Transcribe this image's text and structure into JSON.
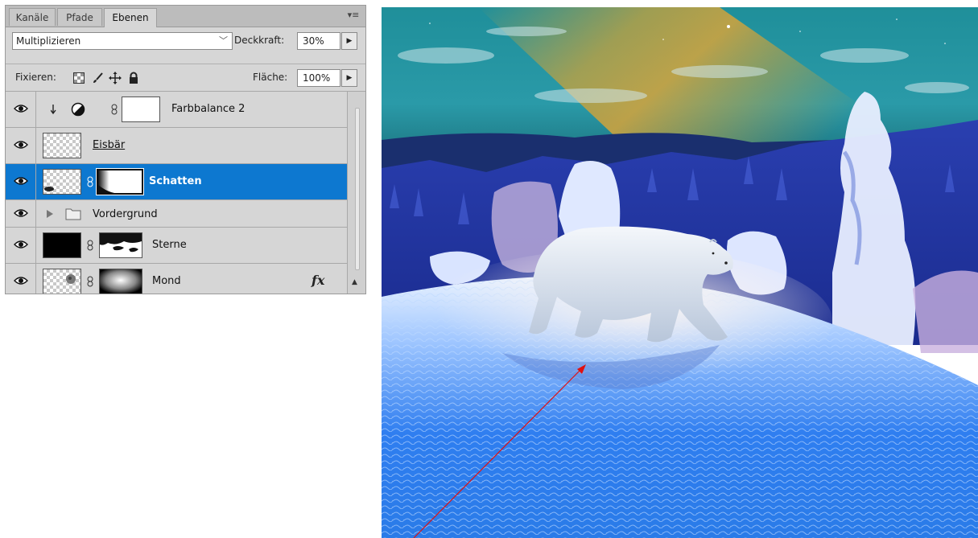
{
  "panel": {
    "tabs": [
      {
        "label": "Kanäle"
      },
      {
        "label": "Pfade"
      },
      {
        "label": "Ebenen"
      }
    ],
    "blend_mode": "Multiplizieren",
    "opacity_label": "Deckkraft:",
    "opacity_value": "30%",
    "lock_label": "Fixieren:",
    "fill_label": "Fläche:",
    "fill_value": "100%",
    "fx_label": "fx",
    "layers": [
      {
        "name": "Farbbalance 2",
        "type": "adjustment",
        "clipped": true
      },
      {
        "name": "Eisbär",
        "type": "pixel"
      },
      {
        "name": "Schatten",
        "type": "pixel-mask",
        "selected": true
      },
      {
        "name": "Vordergrund",
        "type": "group"
      },
      {
        "name": "Sterne",
        "type": "pixel-mask"
      },
      {
        "name": "Mond",
        "type": "pixel-mask",
        "has_fx": true
      }
    ]
  },
  "artwork": {
    "annotation_color": "#e01010",
    "selection_color": "#0d78d0"
  }
}
